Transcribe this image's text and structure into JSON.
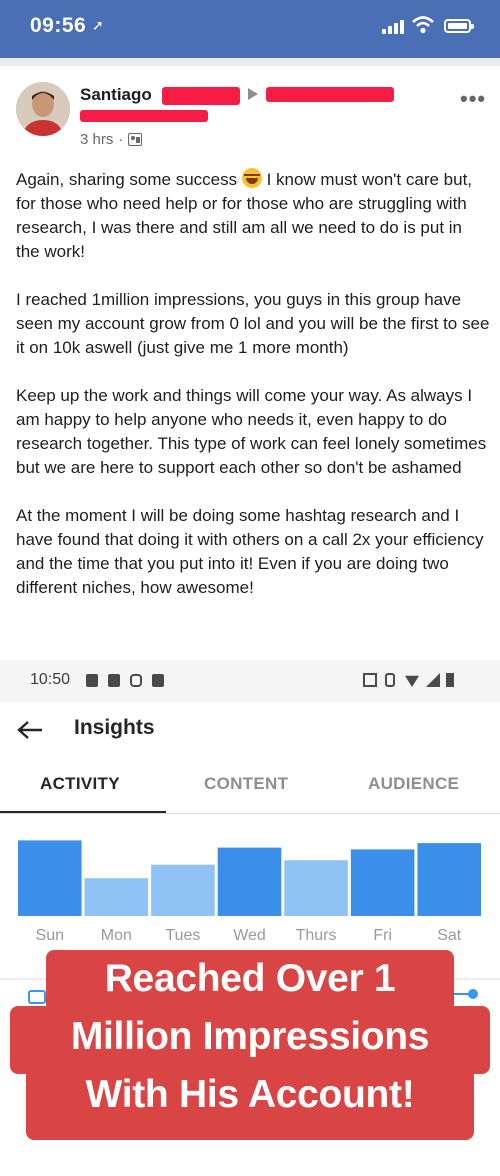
{
  "status_bar": {
    "time": "09:56",
    "location_icon": "location-arrow-icon",
    "signal_icon": "cellular-signal-icon",
    "wifi_icon": "wifi-icon",
    "battery_icon": "battery-icon"
  },
  "post": {
    "author_first_name": "Santiago",
    "time_ago": "3 hrs",
    "separator": "·",
    "audience_icon": "group-icon",
    "more_icon": "more-options-icon",
    "more_label": "•••",
    "redaction_color": "#f51d45",
    "paragraphs": [
      {
        "before_emoji": "Again, sharing some success ",
        "emoji": "laughing-emoji-icon",
        "after_emoji": " I know must won't care but, for those who need help or for those who are struggling with research, I was there and still am all we need to do is put in the work!"
      },
      {
        "text": "I reached 1million impressions, you guys in this group have seen my account grow from 0 lol and you will be the first to see it on 10k aswell (just give me 1 more month)"
      },
      {
        "text": "Keep up the work and things will come your way. As always I am happy to help anyone who needs it, even happy to do research together. This type of work can feel lonely sometimes but we are here to support each other so don't be ashamed"
      },
      {
        "text": "At the moment I will be doing some hashtag research and I have found that doing it with others on a call 2x your efficiency and the time that you put into it! Even if you are doing two different niches, how awesome!"
      }
    ]
  },
  "screenshot": {
    "android_time": "10:50",
    "back_icon": "back-arrow-icon",
    "title": "Insights",
    "tabs": [
      {
        "label": "ACTIVITY",
        "active": true
      },
      {
        "label": "CONTENT",
        "active": false
      },
      {
        "label": "AUDIENCE",
        "active": false
      }
    ]
  },
  "chart_data": {
    "type": "bar",
    "categories": [
      "Sun",
      "Mon",
      "Tues",
      "Wed",
      "Thurs",
      "Fri",
      "Sat"
    ],
    "values": [
      84,
      42,
      57,
      76,
      62,
      74,
      81
    ],
    "ylim": [
      0,
      100
    ],
    "grid": false,
    "title": "",
    "xlabel": "",
    "ylabel": "",
    "colors": {
      "high": "#3b8eea",
      "low": "#90c3f5"
    },
    "highlighted": [
      true,
      false,
      false,
      true,
      false,
      true,
      true
    ]
  },
  "caption": {
    "line1": "Reached Over 1",
    "line2": "Million Impressions",
    "line3": "With His Account!",
    "color": "#d94545"
  }
}
